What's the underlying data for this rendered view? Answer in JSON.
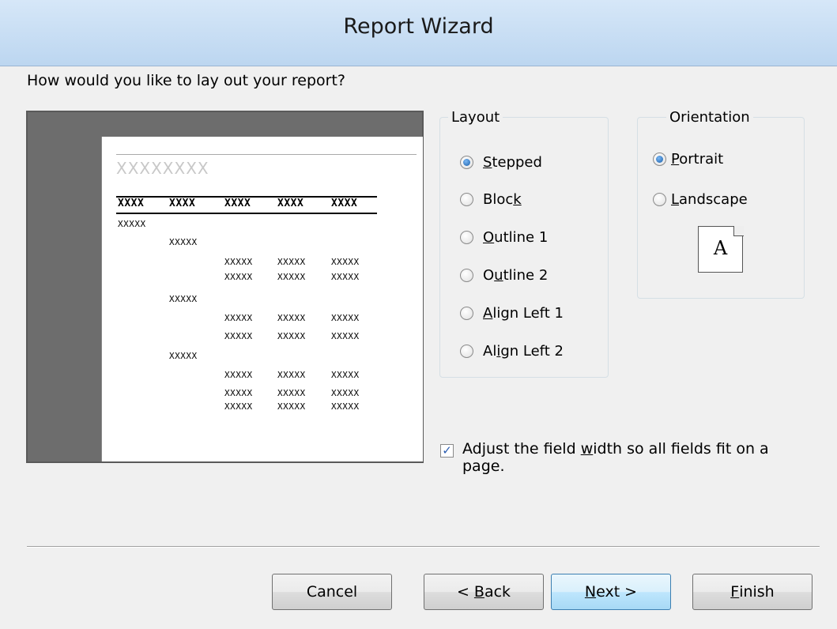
{
  "window": {
    "title": "Report Wizard"
  },
  "prompt": "How would you like to lay out your report?",
  "preview": {
    "title": "XXXXXXXX",
    "header_cells": [
      "XXXX",
      "XXXX",
      "XXXX",
      "XXXX",
      "XXXX"
    ],
    "cell": "XXXXX"
  },
  "layout": {
    "legend": "Layout",
    "options": [
      {
        "pre": "",
        "key": "S",
        "post": "tepped",
        "checked": true
      },
      {
        "pre": "Bloc",
        "key": "k",
        "post": "",
        "checked": false
      },
      {
        "pre": "",
        "key": "O",
        "post": "utline 1",
        "checked": false
      },
      {
        "pre": "O",
        "key": "u",
        "post": "tline 2",
        "checked": false
      },
      {
        "pre": "",
        "key": "A",
        "post": "lign Left 1",
        "checked": false
      },
      {
        "pre": "Al",
        "key": "i",
        "post": "gn Left 2",
        "checked": false
      }
    ]
  },
  "orientation": {
    "legend": "Orientation",
    "options": [
      {
        "pre": "",
        "key": "P",
        "post": "ortrait",
        "checked": true
      },
      {
        "pre": "",
        "key": "L",
        "post": "andscape",
        "checked": false
      }
    ],
    "page_icon_letter": "A"
  },
  "adjust_width": {
    "pre": "Adjust the field ",
    "key": "w",
    "post": "idth so all fields fit on a page.",
    "checked": true
  },
  "buttons": {
    "cancel": {
      "pre": "Cancel",
      "key": "",
      "post": ""
    },
    "back": {
      "pre": "< ",
      "key": "B",
      "post": "ack"
    },
    "next": {
      "pre": "",
      "key": "N",
      "post": "ext >"
    },
    "finish": {
      "pre": "",
      "key": "F",
      "post": "inish"
    }
  }
}
